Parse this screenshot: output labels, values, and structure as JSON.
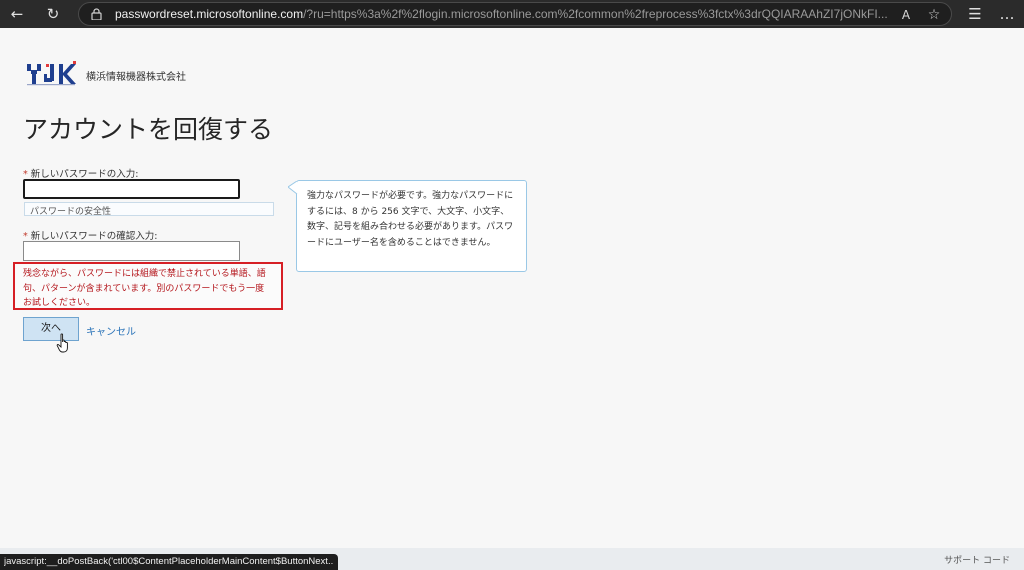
{
  "browser": {
    "url_host": "passwordreset.microsoftonline.com",
    "url_rest": "/?ru=https%3a%2f%2flogin.microsoftonline.com%2fcommon%2freprocess%3fctx%3drQQIARAAhZI7jONkFI...",
    "reader_icon_glyph": "A",
    "favorite_icon_glyph": "☆",
    "collections_icon_glyph": "☰",
    "more_icon_glyph": "…",
    "back_glyph": "←",
    "refresh_glyph": "↻"
  },
  "logo": {
    "mark_text": "YJK",
    "company_name": "横浜情報機器株式会社",
    "colors": {
      "dark_blue": "#1f3f8f",
      "red": "#e23a3a"
    }
  },
  "page": {
    "title": "アカウントを回復する",
    "required_marker": "*",
    "new_password_label": "新しいパスワードの入力:",
    "strength_label": "パスワードの安全性",
    "confirm_password_label": "新しいパスワードの確認入力:",
    "error_message": "残念ながら、パスワードには組織で禁止されている単語、語句、パターンが含まれています。別のパスワードでもう一度お試しください。",
    "next_button": "次へ",
    "cancel_link": "キャンセル",
    "tooltip_text": "強力なパスワードが必要です。強力なパスワードにするには、8 から 256 文字で、大文字、小文字、数字、記号を組み合わせる必要があります。パスワードにユーザー名を含めることはできません。"
  },
  "footer": {
    "support_code": "サポート コード"
  },
  "status_bar": {
    "text": "javascript:__doPostBack('ctl00$ContentPlaceholderMainContent$ButtonNext..."
  },
  "colors": {
    "error_red": "#d61f25",
    "link_blue": "#2a73b8",
    "button_bg": "#cfe3f3",
    "tooltip_border": "#9ac8e6"
  }
}
